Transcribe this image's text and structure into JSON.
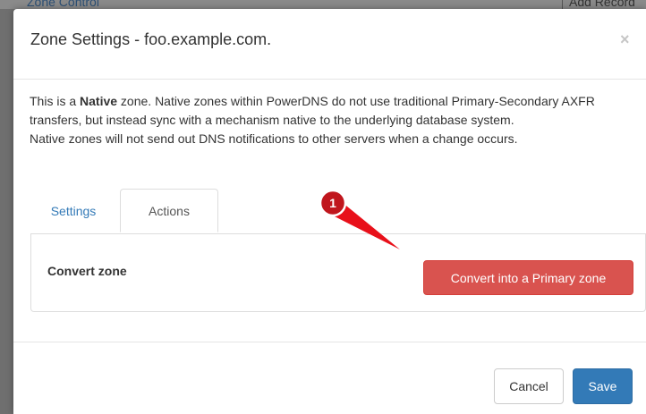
{
  "background": {
    "left_text": "Zone Control",
    "right_text": "Add Record"
  },
  "modal": {
    "title": "Zone Settings - foo.example.com.",
    "close_glyph": "×",
    "description": {
      "line1_prefix": "This is a ",
      "line1_bold": "Native",
      "line1_suffix": " zone. Native zones within PowerDNS do not use traditional Primary-Secondary AXFR transfers, but instead sync with a mechanism native to the underlying database system.",
      "line2": "Native zones will not send out DNS notifications to other servers when a change occurs."
    },
    "tabs": [
      {
        "label": "Settings",
        "active": false
      },
      {
        "label": "Actions",
        "active": true
      }
    ],
    "actions_panel": {
      "label": "Convert zone",
      "button": "Convert into a Primary zone"
    },
    "footer": {
      "cancel": "Cancel",
      "save": "Save"
    }
  },
  "annotation": {
    "marker_number": "1"
  },
  "colors": {
    "danger": "#d9534f",
    "primary": "#337ab7",
    "link": "#337ab7",
    "annotation_red": "#e8101a"
  }
}
